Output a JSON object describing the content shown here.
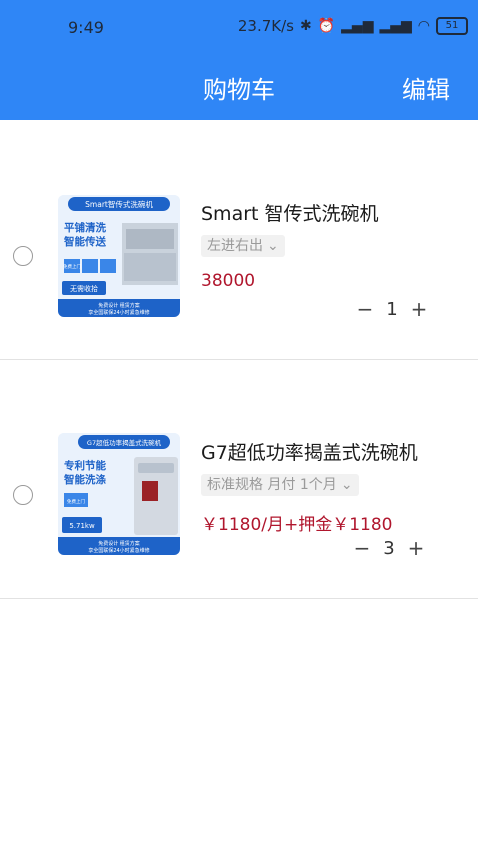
{
  "status_bar": {
    "time": "9:49",
    "net_speed": "23.7K/s",
    "battery": "51"
  },
  "header": {
    "title": "购物车",
    "edit_label": "编辑"
  },
  "cart": {
    "items": [
      {
        "title": "Smart 智传式洗碗机",
        "spec": "左进右出",
        "price": "38000",
        "quantity": "1",
        "thumb": {
          "banner": "Smart智传式洗碗机",
          "line1": "平铺清洗",
          "line2": "智能传送",
          "tag": "免费上门",
          "badge": "无需收拾",
          "footer1": "免费设计 租赁方案",
          "footer2": "享全国联保24小时紧急维修"
        }
      },
      {
        "title": "G7超低功率揭盖式洗碗机",
        "spec": "标准规格 月付 1个月",
        "price": "￥1180/月+押金￥1180",
        "quantity": "3",
        "thumb": {
          "banner": "G7超低功率揭盖式洗碗机",
          "line1": "专利节能",
          "line2": "智能洗涤",
          "tag": "免费上门",
          "badge": "5.71kw",
          "footer1": "免费设计 租赁方案",
          "footer2": "享全国联保24小时紧急维修"
        }
      }
    ]
  },
  "icons": {
    "minus": "−",
    "plus": "+",
    "chevron": "⌄"
  }
}
